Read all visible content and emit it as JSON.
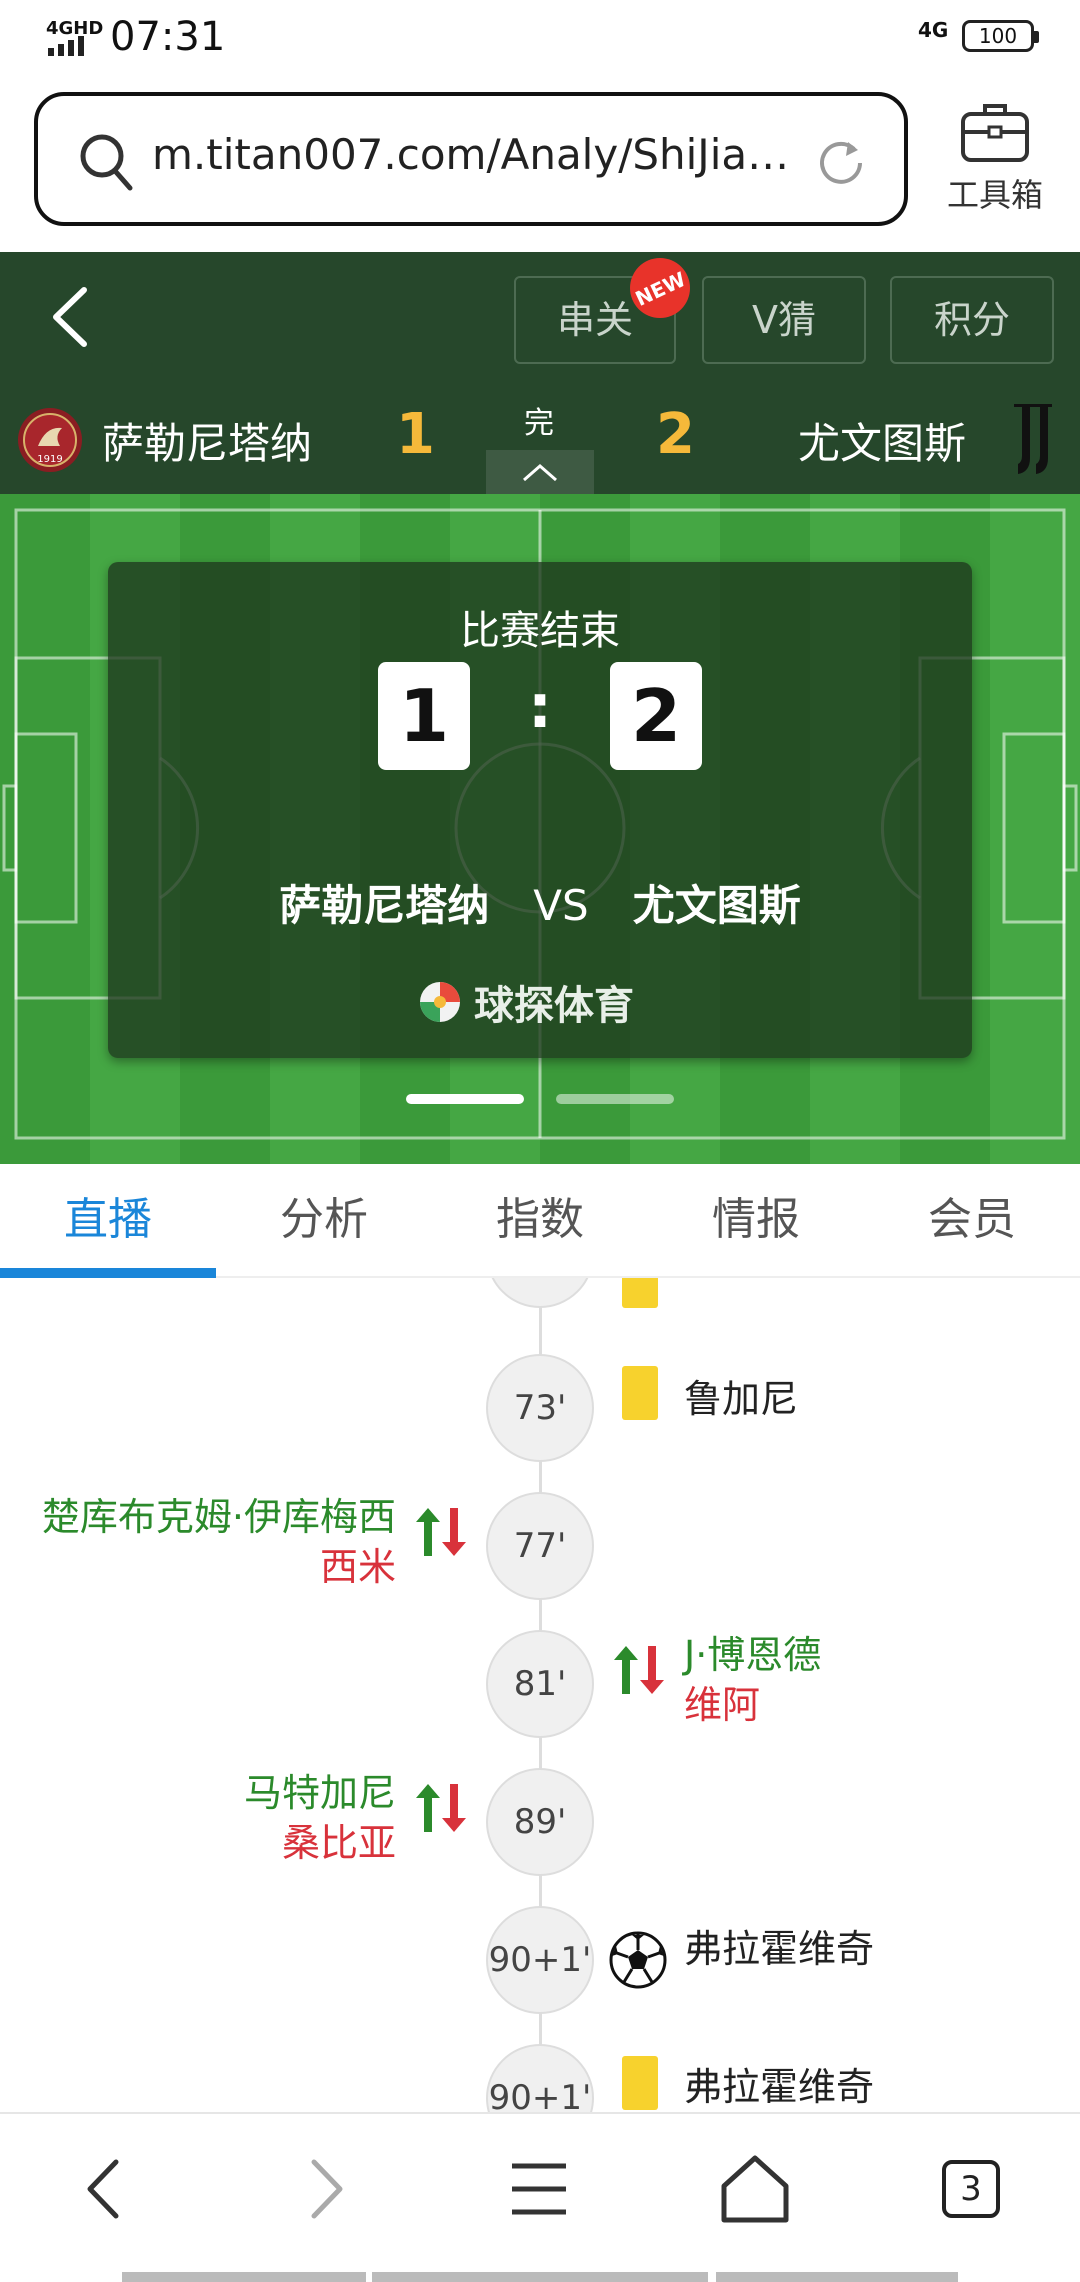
{
  "status_bar": {
    "network": "4GHD",
    "time": "07:31",
    "network_right": "4G",
    "battery": "100"
  },
  "browser": {
    "url": "m.titan007.com/Analy/ShiJia…",
    "toolbox_label": "工具箱"
  },
  "header": {
    "buttons": [
      "串关",
      "V猜",
      "积分"
    ],
    "new_badge": "NEW",
    "home_team": "萨勒尼塔纳",
    "away_team": "尤文图斯",
    "home_score": "1",
    "away_score": "2",
    "status": "完",
    "home_logo_text": "1919"
  },
  "scoreboard": {
    "status": "比赛结束",
    "home_score": "1",
    "colon": ":",
    "away_score": "2",
    "home_team": "萨勒尼塔纳",
    "vs": "VS",
    "away_team": "尤文图斯",
    "brand": "球探体育"
  },
  "tabs": [
    "直播",
    "分析",
    "指数",
    "情报",
    "会员"
  ],
  "timeline": {
    "events": [
      {
        "minute": "73'",
        "side": "away",
        "type": "yellow_card",
        "player": "鲁加尼"
      },
      {
        "minute": "77'",
        "side": "home",
        "type": "substitution",
        "player_in": "楚库布克姆·伊库梅西",
        "player_out": "西米"
      },
      {
        "minute": "81'",
        "side": "away",
        "type": "substitution",
        "player_in": "J·博恩德",
        "player_out": "维阿"
      },
      {
        "minute": "89'",
        "side": "home",
        "type": "substitution",
        "player_in": "马特加尼",
        "player_out": "桑比亚"
      },
      {
        "minute": "90+1'",
        "side": "away",
        "type": "goal",
        "player": "弗拉霍维奇"
      },
      {
        "minute": "90+1'",
        "side": "away",
        "type": "yellow_card",
        "player": "弗拉霍维奇"
      }
    ]
  },
  "bottom_nav": {
    "tab_count": "3"
  },
  "colors": {
    "header_bg": "#26472b",
    "score_accent": "#f5b93a",
    "tab_active": "#1a86d9",
    "sub_in": "#2b8a2b",
    "sub_out": "#d8323b",
    "yellow_card": "#f7d22d"
  }
}
